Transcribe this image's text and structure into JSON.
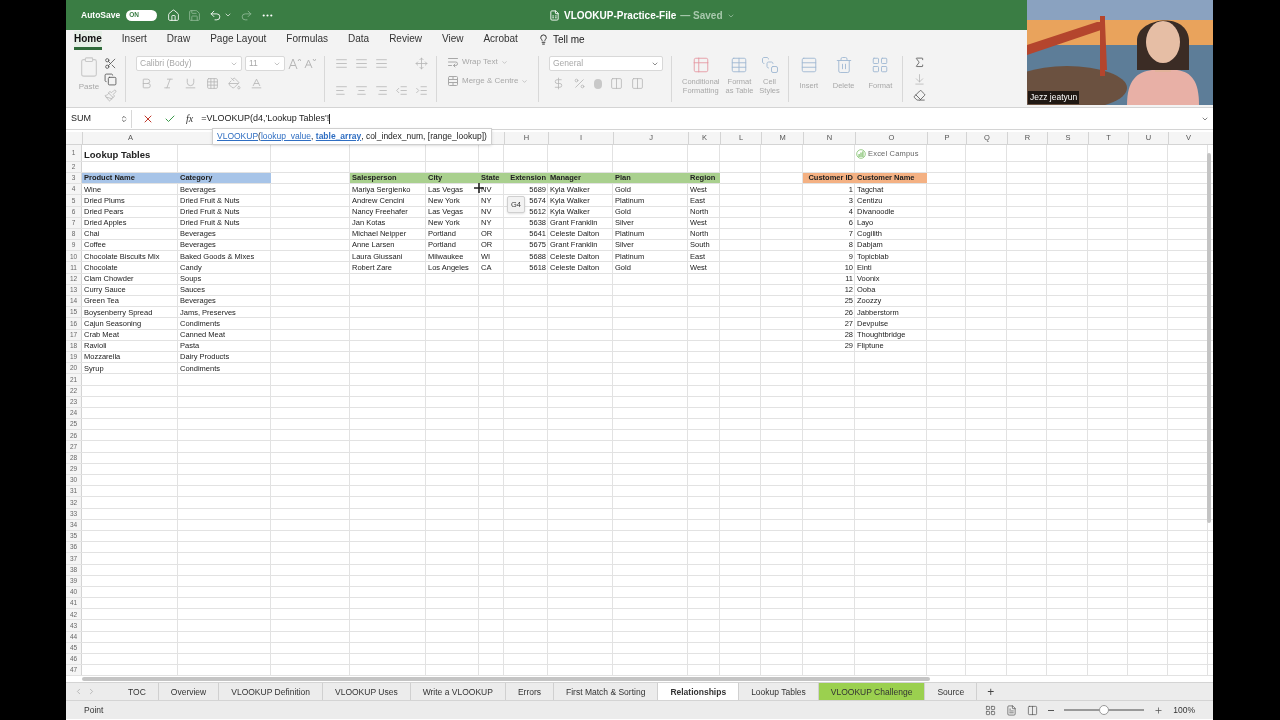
{
  "title_bar": {
    "autosave_label": "AutoSave",
    "autosave_on": true,
    "autosave_state": "ON",
    "file_name": "VLOOKUP-Practice-File",
    "saved_status": "— Saved"
  },
  "menu_tabs": [
    {
      "label": "Home",
      "selected": true,
      "kind": "tab"
    },
    {
      "label": "Insert",
      "selected": false,
      "kind": "tab"
    },
    {
      "label": "Draw",
      "selected": false,
      "kind": "tab"
    },
    {
      "label": "Page Layout",
      "selected": false,
      "kind": "tab"
    },
    {
      "label": "Formulas",
      "selected": false,
      "kind": "tab"
    },
    {
      "label": "Data",
      "selected": false,
      "kind": "tab"
    },
    {
      "label": "Review",
      "selected": false,
      "kind": "tab"
    },
    {
      "label": "View",
      "selected": false,
      "kind": "tab"
    },
    {
      "label": "Acrobat",
      "selected": false,
      "kind": "tab"
    },
    {
      "label": "Tell me",
      "kind": "tell-me"
    }
  ],
  "ribbon": {
    "disabled": true,
    "paste": "Paste",
    "font_name": "Calibri (Body)",
    "font_size": "11",
    "wrap_text": "Wrap Text",
    "merge": "Merge & Centre",
    "number_format": "General",
    "style_buttons": [
      {
        "lines": [
          "Conditional",
          "Formatting"
        ],
        "kind": "conditional"
      },
      {
        "lines": [
          "Format",
          "as Table"
        ],
        "kind": "table"
      },
      {
        "lines": [
          "Cell",
          "Styles"
        ],
        "kind": "styles"
      }
    ],
    "cell_buttons": [
      {
        "label": "Insert",
        "kind": "insert"
      },
      {
        "label": "Delete",
        "kind": "delete"
      },
      {
        "label": "Format",
        "kind": "format"
      }
    ]
  },
  "formula_bar": {
    "name_box": "SUM",
    "function_label": "fx",
    "formula": "=VLOOKUP(d4,'Lookup Tables'!"
  },
  "autocomplete": [
    {
      "text": "VLOOKUP",
      "kind": "function"
    },
    {
      "text": "(",
      "kind": "plain"
    },
    {
      "text": "lookup_value",
      "kind": "link"
    },
    {
      "text": ", ",
      "kind": "plain"
    },
    {
      "text": "table_array",
      "kind": "current"
    },
    {
      "text": ", col_index_num, [range_lookup])",
      "kind": "plain"
    }
  ],
  "column_headers": [
    "A",
    "H",
    "I",
    "J",
    "K",
    "L",
    "M",
    "N",
    "O",
    "P",
    "Q",
    "R",
    "S",
    "T",
    "U",
    "V"
  ],
  "row_numbers": [
    "1",
    "2",
    "3",
    "4",
    "5",
    "6",
    "7",
    "8",
    "9",
    "10",
    "11",
    "12",
    "13",
    "14",
    "15",
    "16",
    "17",
    "18",
    "19",
    "20",
    "21",
    "22",
    "23",
    "24",
    "25",
    "26",
    "27",
    "28",
    "29",
    "30",
    "31",
    "32",
    "33",
    "34",
    "35",
    "36",
    "37",
    "38",
    "39",
    "40",
    "41",
    "42",
    "43",
    "44",
    "45",
    "46",
    "47"
  ],
  "sheet_title": "Lookup Tables",
  "watermark_logo": "Excel Campus",
  "product_table": {
    "color": "#a7c4e8",
    "columns": [
      {
        "label": "Product Name",
        "kind": "text"
      },
      {
        "label": "Category",
        "kind": "text"
      }
    ],
    "rows": [
      [
        "Wine",
        "Beverages"
      ],
      [
        "Dried Plums",
        "Dried Fruit & Nuts"
      ],
      [
        "Dried Pears",
        "Dried Fruit & Nuts"
      ],
      [
        "Dried Apples",
        "Dried Fruit & Nuts"
      ],
      [
        "Chai",
        "Beverages"
      ],
      [
        "Coffee",
        "Beverages"
      ],
      [
        "Chocolate Biscuits Mix",
        "Baked Goods & Mixes"
      ],
      [
        "Chocolate",
        "Candy"
      ],
      [
        "Clam Chowder",
        "Soups"
      ],
      [
        "Curry Sauce",
        "Sauces"
      ],
      [
        "Green Tea",
        "Beverages"
      ],
      [
        "Boysenberry Spread",
        "Jams, Preserves"
      ],
      [
        "Cajun Seasoning",
        "Condiments"
      ],
      [
        "Crab Meat",
        "Canned Meat"
      ],
      [
        "Ravioli",
        "Pasta"
      ],
      [
        "Mozzarella",
        "Dairy Products"
      ],
      [
        "Syrup",
        "Condiments"
      ]
    ]
  },
  "sales_table": {
    "color": "#a9d08e",
    "columns": [
      {
        "label": "Salesperson",
        "kind": "text"
      },
      {
        "label": "City",
        "kind": "text"
      },
      {
        "label": "State",
        "kind": "text"
      },
      {
        "label": "Extension",
        "kind": "number"
      },
      {
        "label": "Manager",
        "kind": "text"
      },
      {
        "label": "Plan",
        "kind": "text"
      },
      {
        "label": "Region",
        "kind": "text"
      }
    ],
    "rows": [
      [
        "Mariya Sergienko",
        "Las Vegas",
        "NV",
        "5689",
        "Kyla Walker",
        "Gold",
        "West"
      ],
      [
        "Andrew Cencini",
        "New York",
        "NY",
        "5674",
        "Kyla Walker",
        "Platinum",
        "East"
      ],
      [
        "Nancy Freehafer",
        "Las Vegas",
        "NV",
        "5612",
        "Kyla Walker",
        "Gold",
        "North"
      ],
      [
        "Jan Kotas",
        "New York",
        "NY",
        "5638",
        "Grant Franklin",
        "Silver",
        "West"
      ],
      [
        "Michael Neipper",
        "Portland",
        "OR",
        "5641",
        "Celeste Dalton",
        "Platinum",
        "North"
      ],
      [
        "Anne Larsen",
        "Portland",
        "OR",
        "5675",
        "Grant Franklin",
        "Silver",
        "South"
      ],
      [
        "Laura Giussani",
        "Milwaukee",
        "WI",
        "5688",
        "Celeste Dalton",
        "Platinum",
        "East"
      ],
      [
        "Robert Zare",
        "Los Angeles",
        "CA",
        "5618",
        "Celeste Dalton",
        "Gold",
        "West"
      ]
    ]
  },
  "customer_table": {
    "color": "#f4b183",
    "columns": [
      {
        "label": "Customer ID",
        "kind": "number"
      },
      {
        "label": "Customer Name",
        "kind": "text"
      }
    ],
    "rows": [
      [
        "1",
        "Tagchat"
      ],
      [
        "3",
        "Centizu"
      ],
      [
        "4",
        "Divanoodle"
      ],
      [
        "6",
        "Layo"
      ],
      [
        "7",
        "Cogilith"
      ],
      [
        "8",
        "Dabjam"
      ],
      [
        "9",
        "Topicblab"
      ],
      [
        "10",
        "Einti"
      ],
      [
        "11",
        "Voonix"
      ],
      [
        "12",
        "Ooba"
      ],
      [
        "25",
        "Zoozzy"
      ],
      [
        "26",
        "Jabberstorm"
      ],
      [
        "27",
        "Devpulse"
      ],
      [
        "28",
        "Thoughtbridge"
      ],
      [
        "29",
        "Fliptune"
      ]
    ]
  },
  "cell_tag": "G4",
  "sheet_tabs": [
    {
      "label": "TOC",
      "selected": false
    },
    {
      "label": "Overview",
      "selected": false
    },
    {
      "label": "VLOOKUP Definition",
      "selected": false
    },
    {
      "label": "VLOOKUP Uses",
      "selected": false
    },
    {
      "label": "Write a VLOOKUP",
      "selected": false
    },
    {
      "label": "Errors",
      "selected": false
    },
    {
      "label": "First Match & Sorting",
      "selected": false
    },
    {
      "label": "Relationships",
      "selected": true
    },
    {
      "label": "Lookup Tables",
      "selected": false
    },
    {
      "label": "VLOOKUP Challenge",
      "selected": false,
      "color": "#9bd04f"
    },
    {
      "label": "Source",
      "selected": false
    }
  ],
  "add_sheet": "+",
  "status_bar": {
    "mode": "Point",
    "zoom": {
      "level": 0.5
    },
    "zoom_reading": "100%"
  },
  "webcam": {
    "kind": "picture",
    "name": "Jezz jeatyun"
  }
}
